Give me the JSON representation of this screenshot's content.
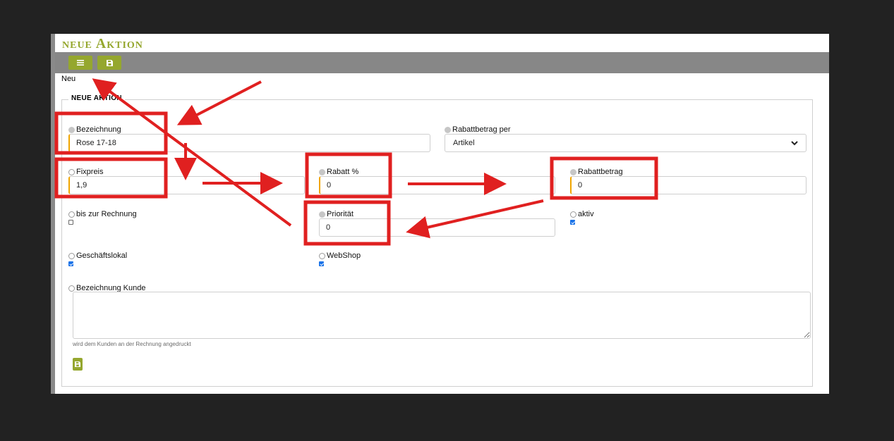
{
  "page": {
    "title": "neue Aktion",
    "breadcrumb": "Neu",
    "section_legend": "NEUE AKTION"
  },
  "toolbar": {
    "menu_icon": "list-icon",
    "save_icon": "floppy-disk-icon"
  },
  "form": {
    "bezeichnung": {
      "label": "Bezeichnung",
      "value": "Rose 17-18"
    },
    "rabattbetrag_per": {
      "label": "Rabattbetrag per",
      "value": "Artikel"
    },
    "fixpreis": {
      "label": "Fixpreis",
      "value": "1,9"
    },
    "rabatt_prozent": {
      "label": "Rabatt %",
      "value": "0"
    },
    "rabattbetrag": {
      "label": "Rabattbetrag",
      "value": "0"
    },
    "bis_zur_rechnung": {
      "label": "bis zur Rechnung",
      "checked": false
    },
    "prioritaet": {
      "label": "Priorität",
      "value": "0"
    },
    "aktiv": {
      "label": "aktiv",
      "checked": true
    },
    "geschaeftslokal": {
      "label": "Geschäftslokal",
      "checked": true
    },
    "webshop": {
      "label": "WebShop",
      "checked": true
    },
    "bezeichnung_kunde": {
      "label": "Bezeichnung Kunde",
      "value": "",
      "hint": "wird dem Kunden an der Rechnung angedruckt"
    }
  },
  "colors": {
    "accent": "#95a72e",
    "toolbar": "#878787",
    "annotation": "#e02020",
    "required": "#f0a500"
  }
}
